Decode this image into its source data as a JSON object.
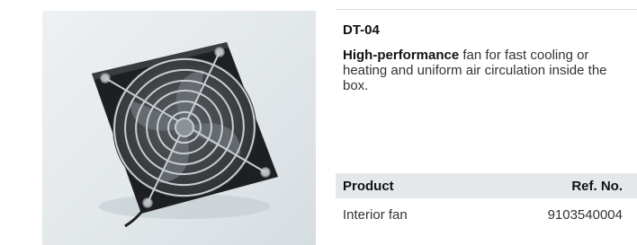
{
  "product": {
    "code": "DT-04",
    "description_bold": "High-performance",
    "description_rest": " fan for fast cooling or heating and uniform air circulation inside the box."
  },
  "table": {
    "headers": {
      "product": "Product",
      "ref_no": "Ref. No."
    },
    "rows": [
      {
        "product": "Interior fan",
        "ref_no": "9103540004"
      }
    ]
  },
  "image": {
    "subject": "fan-with-guard-grille"
  },
  "colors": {
    "panel_background": "#e3e8eb",
    "table_header_background": "#e4e8ea"
  }
}
